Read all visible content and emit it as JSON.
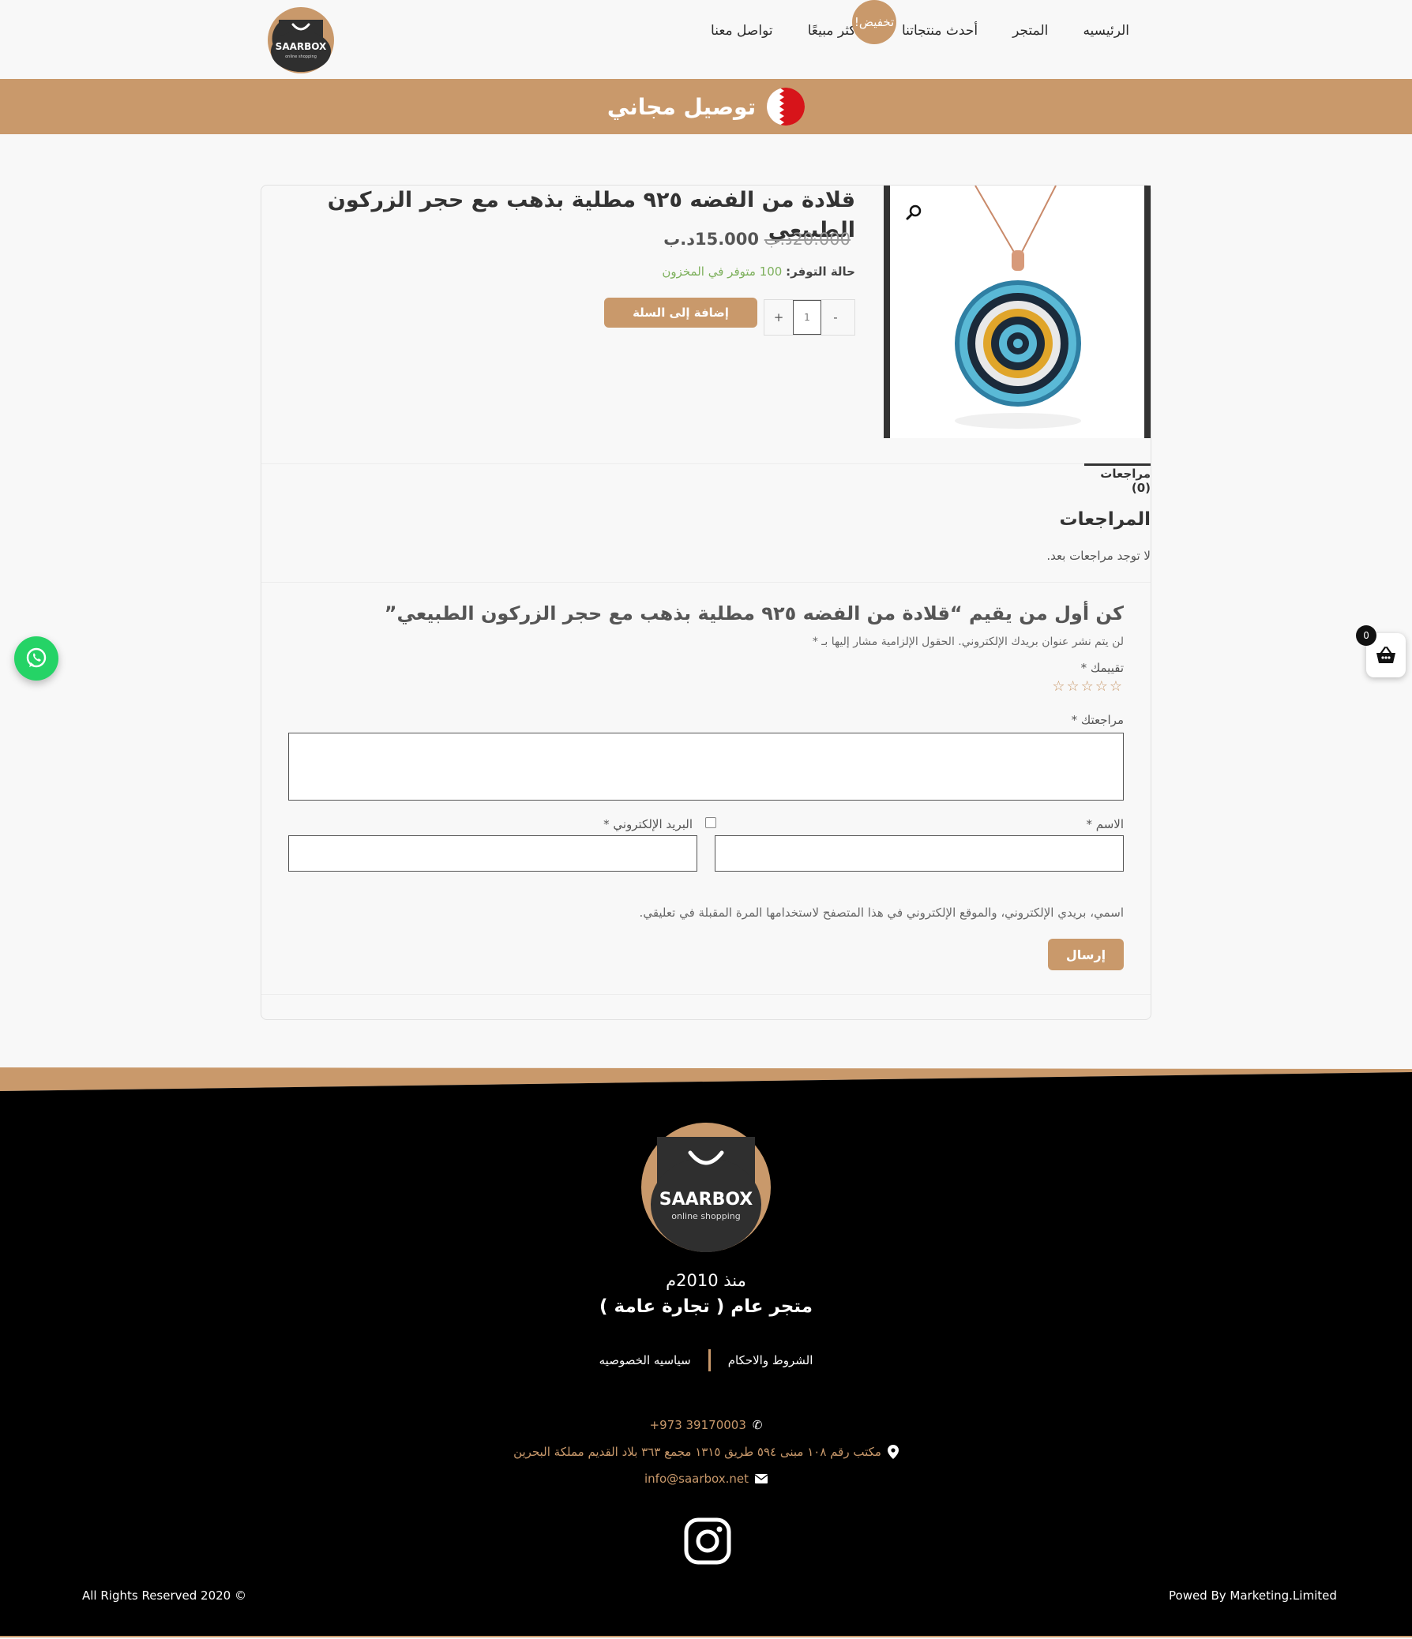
{
  "header": {
    "logo_text": "SAARBOX",
    "logo_subtext": "online shopping",
    "nav": [
      "الرئيسيه",
      "المتجر",
      "أحدث منتجاتنا",
      "الأكثر مبيعًا",
      "تواصل معنا"
    ]
  },
  "promo": {
    "text": "توصيل مجاني"
  },
  "product": {
    "sale_badge": "تخفيض!",
    "title": "قلادة من الفضه ٩٢٥ مطلية بذهب مع حجر الزركون الطبيعي",
    "price_old": "20.000د.ب",
    "price_new": "15.000د.ب",
    "stock_label": "حالة التوفر:",
    "stock_value": "100 متوفر في المخزون",
    "qty_minus": "-",
    "qty_value": "1",
    "qty_plus": "+",
    "add_to_cart": "إضافة إلى السلة"
  },
  "tabs": {
    "reviews_tab": "مراجعات (0)"
  },
  "reviews": {
    "heading": "المراجعات",
    "empty_text": "لا توجد مراجعات بعد.",
    "reply_title": "كن أول من يقيم “قلادة من الفضه ٩٢٥ مطلية بذهب مع حجر الزركون الطبيعي”",
    "notes": "لن يتم نشر عنوان بريدك الإلكتروني. الحقول الإلزامية مشار إليها بـ *",
    "rating_label": "تقييمك *",
    "stars": "☆☆☆☆☆",
    "review_label": "مراجعتك *",
    "name_label": "الاسم *",
    "email_label": "البريد الإلكتروني *",
    "cookies_note": "اسمي، بريدي الإلكتروني، والموقع الإلكتروني في هذا المتصفح لاستخدامها المرة المقبلة في تعليقي.",
    "submit": "إرسال"
  },
  "floating": {
    "cart_count": "0"
  },
  "footer": {
    "logo_text": "SAARBOX",
    "logo_subtext": "online shopping",
    "since": "منذ 2010م",
    "store_type": "متجر عام ( تجارة عامة )",
    "links": [
      "الشروط والاحكام",
      "سياسيه الخصوصيه"
    ],
    "phone": "+973 39170003",
    "address": "مكتب رقم ١٠٨ مبنى ٥٩٤ طريق ١٣١٥ مجمع ٣٦٣ بلاد القديم مملكة البحرين",
    "email": "info@saarbox.net",
    "rights": "All Rights Reserved 2020 ©",
    "powered": "Powed By Marketing.Limited"
  },
  "colors": {
    "accent": "#c9996b",
    "footer_bg": "#000000",
    "whatsapp": "#25d366"
  }
}
